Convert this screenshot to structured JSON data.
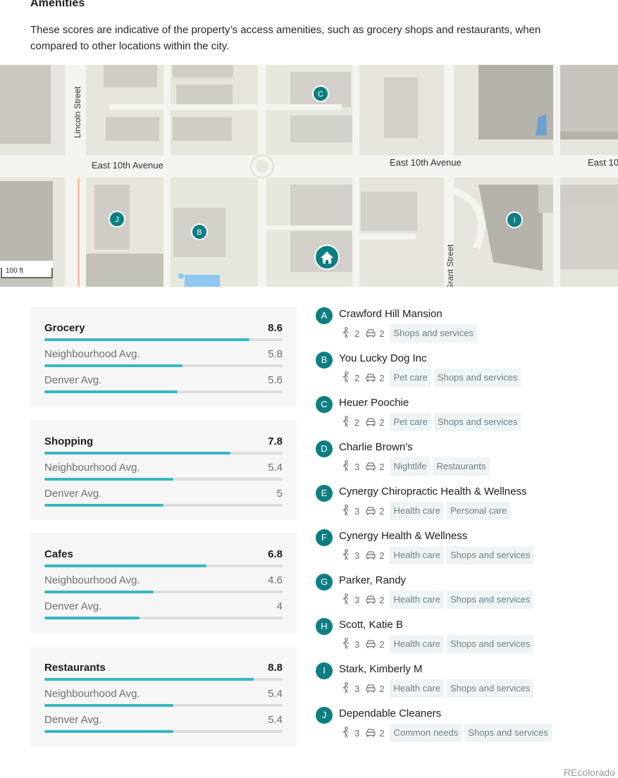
{
  "header": {
    "title": "Amenities",
    "description": "These scores are indicative of the property’s access amenities, such as grocery shops and restaurants, when compared to other locations within the city."
  },
  "map": {
    "streets": [
      "Lincoln Street",
      "East 10th Avenue",
      "East 10th Avenue",
      "East 10",
      "Grant Street"
    ],
    "scale": "100 ft",
    "pins": [
      "C",
      "J",
      "B",
      "I"
    ],
    "home_icon": "home-icon",
    "accent": "#0d7f82"
  },
  "scores": [
    {
      "label": "Grocery",
      "value": "8.6",
      "fraction": 0.86,
      "neighbourhood_label": "Neighbourhood Avg.",
      "neighbourhood_value": "5.8",
      "neighbourhood_fraction": 0.58,
      "city_label": "Denver Avg.",
      "city_value": "5.6",
      "city_fraction": 0.56
    },
    {
      "label": "Shopping",
      "value": "7.8",
      "fraction": 0.78,
      "neighbourhood_label": "Neighbourhood Avg.",
      "neighbourhood_value": "5.4",
      "neighbourhood_fraction": 0.54,
      "city_label": "Denver Avg.",
      "city_value": "5",
      "city_fraction": 0.5
    },
    {
      "label": "Cafes",
      "value": "6.8",
      "fraction": 0.68,
      "neighbourhood_label": "Neighbourhood Avg.",
      "neighbourhood_value": "4.6",
      "neighbourhood_fraction": 0.46,
      "city_label": "Denver Avg.",
      "city_value": "4",
      "city_fraction": 0.4
    },
    {
      "label": "Restaurants",
      "value": "8.8",
      "fraction": 0.88,
      "neighbourhood_label": "Neighbourhood Avg.",
      "neighbourhood_value": "5.4",
      "neighbourhood_fraction": 0.54,
      "city_label": "Denver Avg.",
      "city_value": "5.4",
      "city_fraction": 0.54
    }
  ],
  "bar_color": "#37b7c3",
  "amenities": [
    {
      "letter": "A",
      "name": "Crawford Hill Mansion",
      "walk": "2",
      "drive": "2",
      "tags": [
        "Shops and services"
      ]
    },
    {
      "letter": "B",
      "name": "You Lucky Dog Inc",
      "walk": "2",
      "drive": "2",
      "tags": [
        "Pet care",
        "Shops and services"
      ]
    },
    {
      "letter": "C",
      "name": "Heuer Poochie",
      "walk": "2",
      "drive": "2",
      "tags": [
        "Pet care",
        "Shops and services"
      ]
    },
    {
      "letter": "D",
      "name": "Charlie Brown's",
      "walk": "3",
      "drive": "2",
      "tags": [
        "Nightlife",
        "Restaurants"
      ]
    },
    {
      "letter": "E",
      "name": "Cynergy Chiropractic Health & Wellness",
      "walk": "3",
      "drive": "2",
      "tags": [
        "Health care",
        "Personal care"
      ]
    },
    {
      "letter": "F",
      "name": "Cynergy Health & Wellness",
      "walk": "3",
      "drive": "2",
      "tags": [
        "Health care",
        "Shops and services"
      ]
    },
    {
      "letter": "G",
      "name": "Parker, Randy",
      "walk": "3",
      "drive": "2",
      "tags": [
        "Health care",
        "Shops and services"
      ]
    },
    {
      "letter": "H",
      "name": "Scott, Katie B",
      "walk": "3",
      "drive": "2",
      "tags": [
        "Health care",
        "Shops and services"
      ]
    },
    {
      "letter": "I",
      "name": "Stark, Kimberly M",
      "walk": "3",
      "drive": "2",
      "tags": [
        "Health care",
        "Shops and services"
      ]
    },
    {
      "letter": "J",
      "name": "Dependable Cleaners",
      "walk": "3",
      "drive": "2",
      "tags": [
        "Common needs",
        "Shops and services"
      ]
    }
  ],
  "icons": {
    "walk": "walking-person-icon",
    "drive": "car-icon"
  },
  "footer": {
    "brand": "REcolorado"
  }
}
